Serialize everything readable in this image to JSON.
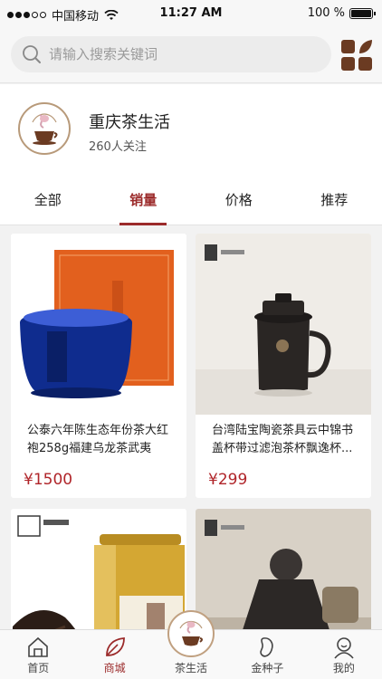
{
  "status_bar": {
    "carrier": "中国移动",
    "time": "11:27 AM",
    "battery": "100 %"
  },
  "search": {
    "placeholder": "请输入搜索关键词"
  },
  "store": {
    "name": "重庆茶生活",
    "followers": "260人关注"
  },
  "tabs": [
    {
      "label": "全部",
      "active": false
    },
    {
      "label": "销量",
      "active": true
    },
    {
      "label": "价格",
      "active": false
    },
    {
      "label": "推荐",
      "active": false
    }
  ],
  "products": [
    {
      "title": "公泰六年陈生态年份茶大红袍258g福建乌龙茶武夷山...",
      "price": "¥1500"
    },
    {
      "title": "台湾陆宝陶瓷茶具云中锦书盖杯带过滤泡茶杯飘逸杯...",
      "price": "¥299"
    },
    {
      "title": "",
      "price": ""
    },
    {
      "title": "",
      "price": ""
    }
  ],
  "tabbar": [
    {
      "label": "首页",
      "icon": "home-icon"
    },
    {
      "label": "商城",
      "icon": "leaf-icon",
      "active": true
    },
    {
      "label": "茶生活",
      "icon": "tea-logo-icon"
    },
    {
      "label": "金种子",
      "icon": "seed-icon"
    },
    {
      "label": "我的",
      "icon": "profile-icon"
    }
  ],
  "colors": {
    "accent": "#9b2a2a",
    "price": "#b0252a",
    "brand_brown": "#6b3b22"
  }
}
